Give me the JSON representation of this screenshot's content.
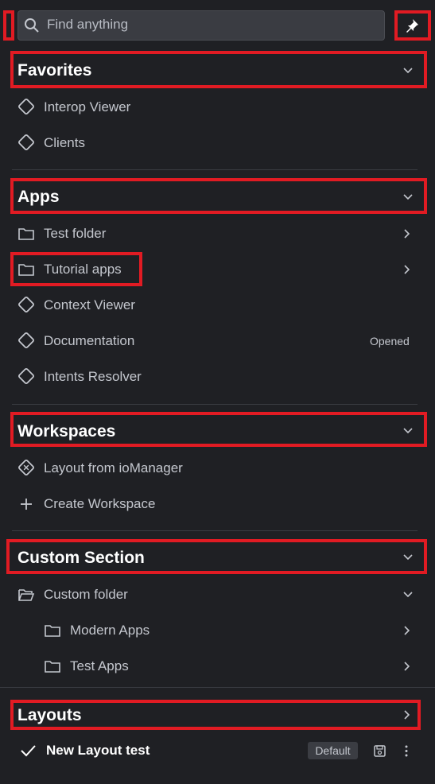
{
  "search": {
    "placeholder": "Find anything"
  },
  "sections": {
    "favorites": {
      "title": "Favorites",
      "items": [
        {
          "label": "Interop Viewer",
          "icon": "app-icon"
        },
        {
          "label": "Clients",
          "icon": "app-icon"
        }
      ]
    },
    "apps": {
      "title": "Apps",
      "items": [
        {
          "label": "Test folder",
          "icon": "folder-icon"
        },
        {
          "label": "Tutorial apps",
          "icon": "folder-icon"
        },
        {
          "label": "Context Viewer",
          "icon": "app-icon"
        },
        {
          "label": "Documentation",
          "icon": "app-icon",
          "status": "Opened"
        },
        {
          "label": "Intents Resolver",
          "icon": "app-icon"
        }
      ]
    },
    "workspaces": {
      "title": "Workspaces",
      "items": [
        {
          "label": "Layout from ioManager",
          "icon": "workspace-icon"
        },
        {
          "label": "Create Workspace",
          "icon": "plus-icon"
        }
      ]
    },
    "custom": {
      "title": "Custom Section",
      "items": [
        {
          "label": "Custom folder",
          "icon": "folder-open-icon"
        },
        {
          "label": "Modern Apps",
          "icon": "folder-icon"
        },
        {
          "label": "Test Apps",
          "icon": "folder-icon"
        }
      ]
    },
    "layouts": {
      "title": "Layouts",
      "items": [
        {
          "label": "New Layout test",
          "icon": "check-icon",
          "badge": "Default"
        }
      ]
    }
  },
  "colors": {
    "background": "#1f2024",
    "highlight": "#e11b23",
    "header_text": "#ffffff",
    "item_text": "#c4c7ce"
  }
}
